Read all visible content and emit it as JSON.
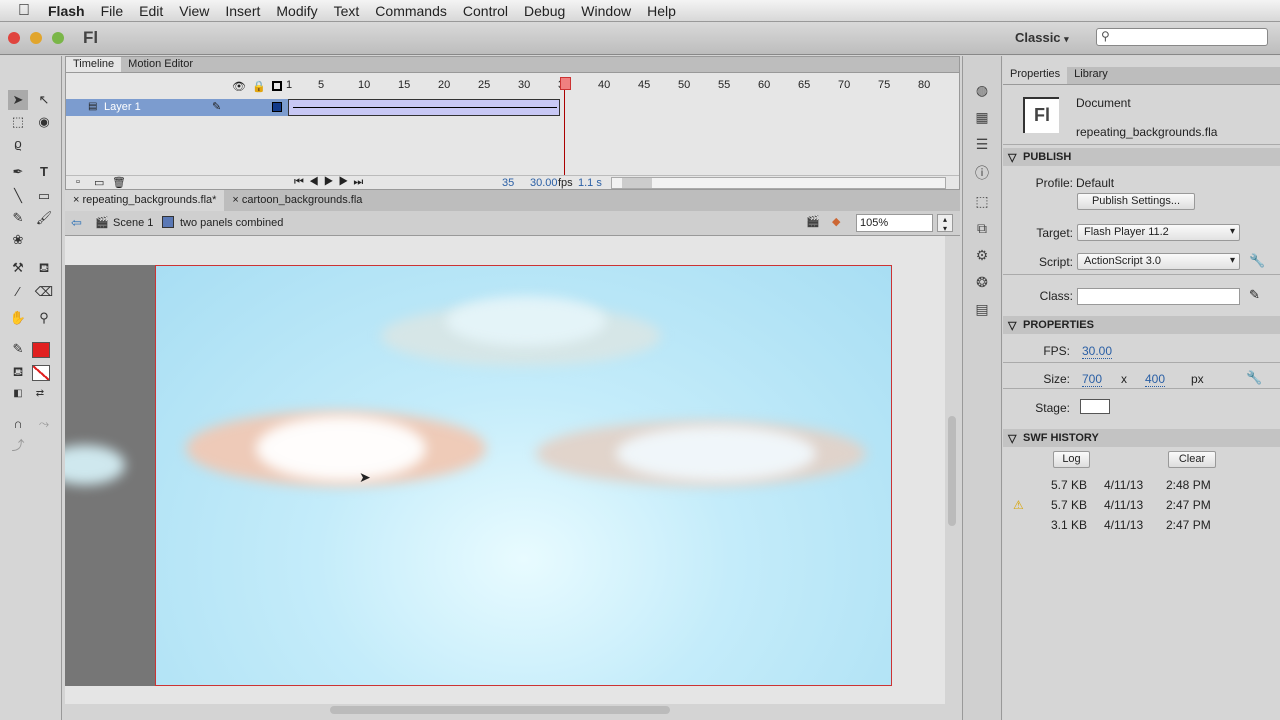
{
  "menubar": {
    "app": "Flash",
    "items": [
      "File",
      "Edit",
      "View",
      "Insert",
      "Modify",
      "Text",
      "Commands",
      "Control",
      "Debug",
      "Window",
      "Help"
    ]
  },
  "appbar": {
    "logo": "Fl",
    "workspace": "Classic",
    "search_placeholder": ""
  },
  "timeline": {
    "tabs": [
      "Timeline",
      "Motion Editor"
    ],
    "frame_numbers": [
      "1",
      "5",
      "10",
      "15",
      "20",
      "25",
      "30",
      "35",
      "40",
      "45",
      "50",
      "55",
      "60",
      "65",
      "70",
      "75",
      "80"
    ],
    "layer": "Layer 1",
    "current_frame": "35",
    "fps": "30.00",
    "fps_unit": "fps",
    "elapsed": "1.1 s"
  },
  "docs": {
    "tabs": [
      "repeating_backgrounds.fla*",
      "cartoon_backgrounds.fla"
    ]
  },
  "editbar": {
    "scene": "Scene 1",
    "symbol": "two panels combined",
    "zoom": "105%"
  },
  "properties": {
    "tabs": [
      "Properties",
      "Library"
    ],
    "doc_type": "Document",
    "doc_name": "repeating_backgrounds.fla",
    "publish": {
      "title": "PUBLISH",
      "profile_label": "Profile:",
      "profile": "Default",
      "settings_button": "Publish Settings...",
      "target_label": "Target:",
      "target": "Flash Player 11.2",
      "script_label": "Script:",
      "script": "ActionScript 3.0",
      "class_label": "Class:",
      "class_value": ""
    },
    "props": {
      "title": "PROPERTIES",
      "fps_label": "FPS:",
      "fps": "30.00",
      "size_label": "Size:",
      "width": "700",
      "x": "x",
      "height": "400",
      "unit": "px",
      "stage_label": "Stage:",
      "stage_color": "#ffffff"
    },
    "history": {
      "title": "SWF HISTORY",
      "log": "Log",
      "clear": "Clear",
      "rows": [
        {
          "size": "5.7 KB",
          "date": "4/11/13",
          "time": "2:48 PM",
          "warn": false
        },
        {
          "size": "5.7 KB",
          "date": "4/11/13",
          "time": "2:47 PM",
          "warn": true
        },
        {
          "size": "3.1 KB",
          "date": "4/11/13",
          "time": "2:47 PM",
          "warn": false
        }
      ]
    }
  }
}
